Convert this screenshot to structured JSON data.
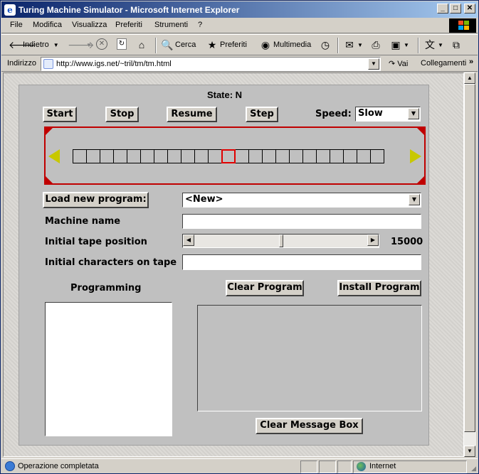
{
  "window": {
    "title": "Turing Machine Simulator - Microsoft Internet Explorer"
  },
  "titlebar_buttons": {
    "minimize": "_",
    "maximize": "□",
    "close": "✕"
  },
  "menubar": {
    "items": [
      "File",
      "Modifica",
      "Visualizza",
      "Preferiti",
      "Strumenti",
      "?"
    ]
  },
  "toolbar": {
    "back_label": "Indietro",
    "search_label": "Cerca",
    "favorites_label": "Preferiti",
    "media_label": "Multimedia"
  },
  "addressbar": {
    "label": "Indirizzo",
    "url": "http://www.igs.net/~tril/tm/tm.html",
    "go_label": "Vai",
    "links_label": "Collegamenti"
  },
  "applet": {
    "state_text": "State: N",
    "buttons": {
      "start": "Start",
      "stop": "Stop",
      "resume": "Resume",
      "step": "Step",
      "load_program": "Load new program:",
      "clear_program": "Clear Program",
      "install_program": "Install Program",
      "clear_message": "Clear Message Box"
    },
    "speed_label": "Speed:",
    "speed_value": "Slow",
    "program_select_value": "<New>",
    "labels": {
      "machine_name": "Machine name",
      "initial_position": "Initial tape position",
      "initial_chars": "Initial characters on tape",
      "programming": "Programming"
    },
    "machine_name_value": "",
    "initial_chars_value": "",
    "tape_position_value": "15000",
    "tape": {
      "cell_count": 23,
      "current_index": 11
    },
    "colors": {
      "tape_border": "#c00000",
      "arrow": "#c8c800",
      "current_cell": "#e00000"
    }
  },
  "statusbar": {
    "status_text": "Operazione completata",
    "zone": "Internet"
  }
}
